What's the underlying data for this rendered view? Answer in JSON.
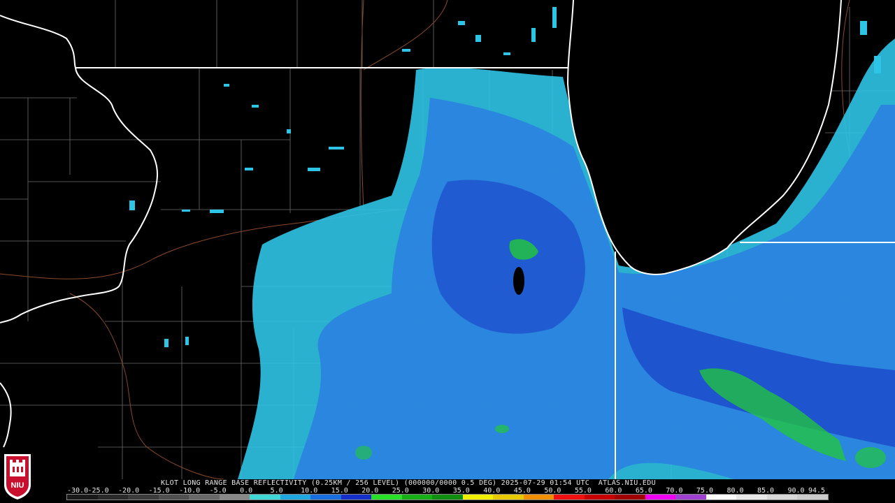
{
  "caption": "KLOT LONG RANGE BASE REFLECTIVITY (0.25KM / 256 LEVEL) (000000/0000 0.5 DEG) 2025-07-29 01:54 UTC  ATLAS.NIU.EDU",
  "logo_text": "NIU",
  "scale": {
    "labels": [
      "-30.0",
      "-25.0",
      "-20.0",
      "-15.0",
      "-10.0",
      "-5.0",
      "0.0",
      "5.0",
      "10.0",
      "15.0",
      "20.0",
      "25.0",
      "30.0",
      "35.0",
      "40.0",
      "45.0",
      "50.0",
      "55.0",
      "60.0",
      "65.0",
      "70.0",
      "75.0",
      "80.0",
      "85.0",
      "90.0",
      "94.5"
    ],
    "colors": [
      "#1a1a1a",
      "#2a2a2a",
      "#3c3c3c",
      "#505050",
      "#686868",
      "#888888",
      "#3fd6d6",
      "#1fa8e0",
      "#1a6fe0",
      "#1530c8",
      "#27e027",
      "#17b017",
      "#0f8f0f",
      "#f0f000",
      "#e8c800",
      "#f09000",
      "#f01010",
      "#c80000",
      "#a00000",
      "#f000f0",
      "#a040d0",
      "#ffffff",
      "#e8e8e8",
      "#d8d8d8",
      "#cccccc"
    ]
  },
  "colors": {
    "background": "#000000",
    "state_border": "#ffffff",
    "county_border": "#7a7a7a",
    "road": "#8a4a2a",
    "echo_light": "#2ec4e6",
    "echo_medium": "#2a7fe0",
    "echo_deep": "#1a3fc8",
    "echo_green": "#23c83a",
    "logo_red": "#c8102e"
  }
}
